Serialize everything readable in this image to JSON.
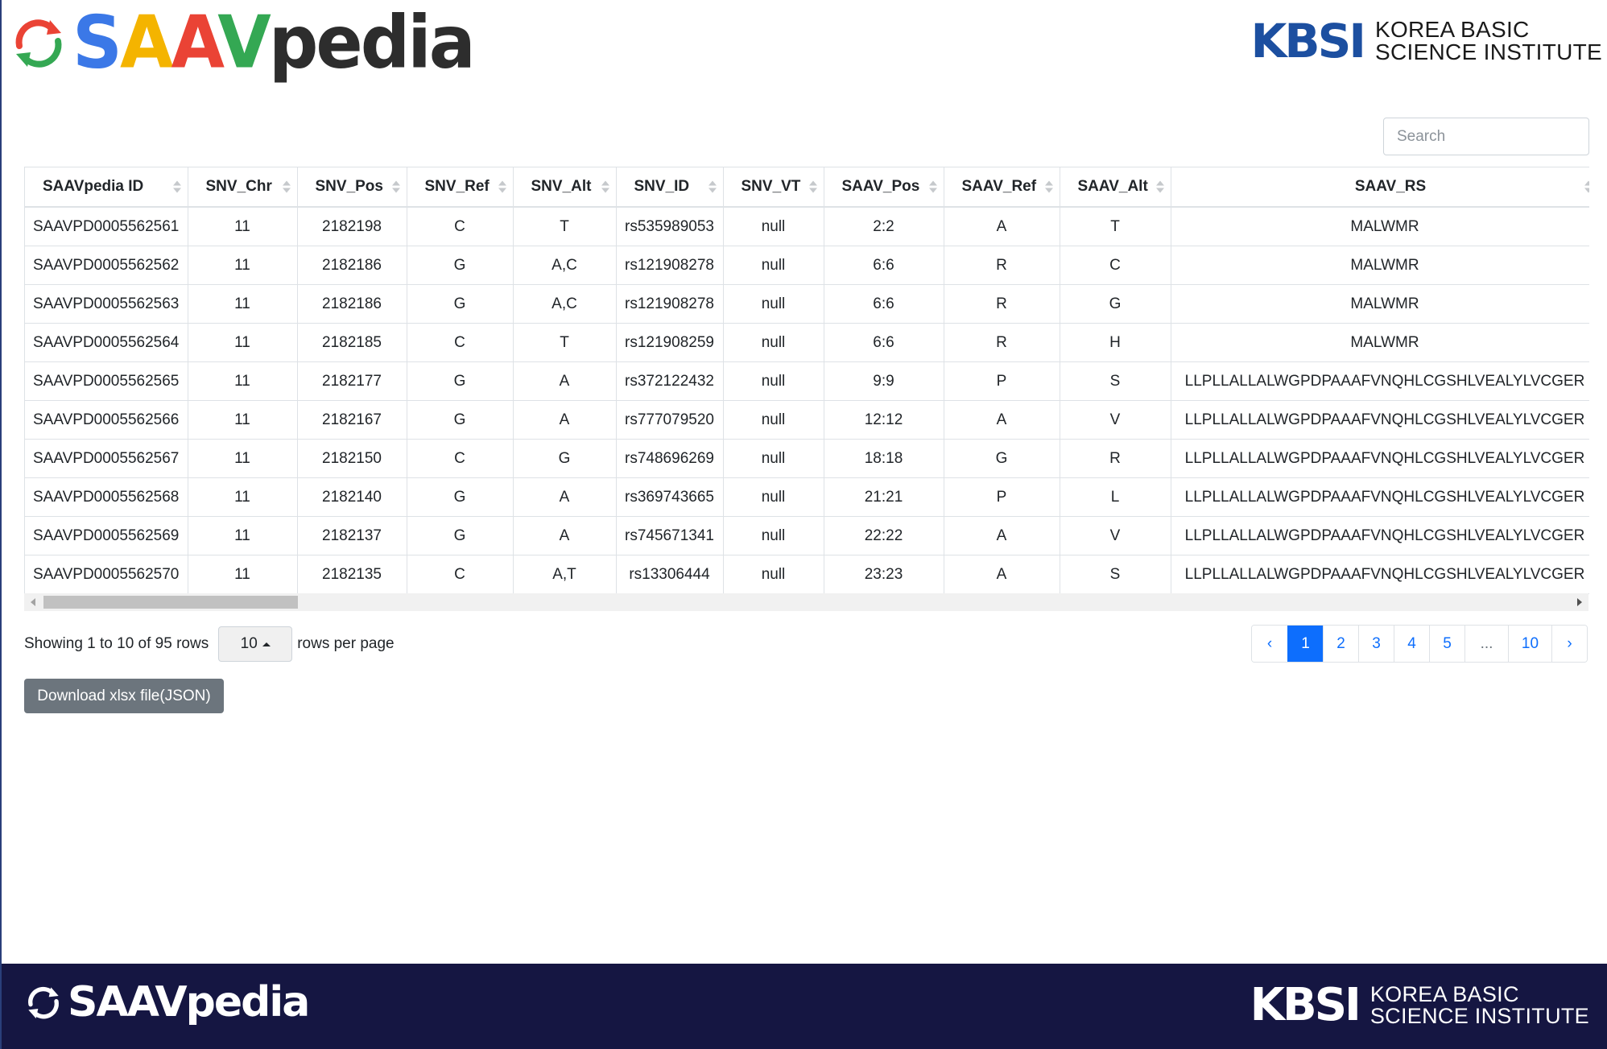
{
  "header": {
    "logo_text": "SAAVpedia",
    "partner_mark": "KBSI",
    "partner_line1": "KOREA BASIC",
    "partner_line2": "SCIENCE INSTITUTE"
  },
  "search": {
    "placeholder": "Search"
  },
  "table": {
    "columns": [
      "SAAVpedia ID",
      "SNV_Chr",
      "SNV_Pos",
      "SNV_Ref",
      "SNV_Alt",
      "SNV_ID",
      "SNV_VT",
      "SAAV_Pos",
      "SAAV_Ref",
      "SAAV_Alt",
      "SAAV_RS"
    ],
    "rows": [
      [
        "SAAVPD0005562561",
        "11",
        "2182198",
        "C",
        "T",
        "rs535989053",
        "null",
        "2:2",
        "A",
        "T",
        "MALWMR"
      ],
      [
        "SAAVPD0005562562",
        "11",
        "2182186",
        "G",
        "A,C",
        "rs121908278",
        "null",
        "6:6",
        "R",
        "C",
        "MALWMR"
      ],
      [
        "SAAVPD0005562563",
        "11",
        "2182186",
        "G",
        "A,C",
        "rs121908278",
        "null",
        "6:6",
        "R",
        "G",
        "MALWMR"
      ],
      [
        "SAAVPD0005562564",
        "11",
        "2182185",
        "C",
        "T",
        "rs121908259",
        "null",
        "6:6",
        "R",
        "H",
        "MALWMR"
      ],
      [
        "SAAVPD0005562565",
        "11",
        "2182177",
        "G",
        "A",
        "rs372122432",
        "null",
        "9:9",
        "P",
        "S",
        "LLPLLALLALWGPDPAAAFVNQHLCGSHLVEALYLVCGER"
      ],
      [
        "SAAVPD0005562566",
        "11",
        "2182167",
        "G",
        "A",
        "rs777079520",
        "null",
        "12:12",
        "A",
        "V",
        "LLPLLALLALWGPDPAAAFVNQHLCGSHLVEALYLVCGER"
      ],
      [
        "SAAVPD0005562567",
        "11",
        "2182150",
        "C",
        "G",
        "rs748696269",
        "null",
        "18:18",
        "G",
        "R",
        "LLPLLALLALWGPDPAAAFVNQHLCGSHLVEALYLVCGER"
      ],
      [
        "SAAVPD0005562568",
        "11",
        "2182140",
        "G",
        "A",
        "rs369743665",
        "null",
        "21:21",
        "P",
        "L",
        "LLPLLALLALWGPDPAAAFVNQHLCGSHLVEALYLVCGER"
      ],
      [
        "SAAVPD0005562569",
        "11",
        "2182137",
        "G",
        "A",
        "rs745671341",
        "null",
        "22:22",
        "A",
        "V",
        "LLPLLALLALWGPDPAAAFVNQHLCGSHLVEALYLVCGER"
      ],
      [
        "SAAVPD0005562570",
        "11",
        "2182135",
        "C",
        "A,T",
        "rs13306444",
        "null",
        "23:23",
        "A",
        "S",
        "LLPLLALLALWGPDPAAAFVNQHLCGSHLVEALYLVCGER"
      ]
    ]
  },
  "pagination": {
    "info_text": "Showing 1 to 10 of 95 rows",
    "page_size": "10",
    "page_size_suffix": "rows per page",
    "prev": "‹",
    "next": "›",
    "pages": [
      "1",
      "2",
      "3",
      "4",
      "5",
      "...",
      "10"
    ],
    "active_page": "1"
  },
  "download": {
    "label": "Download xlsx file(JSON)"
  },
  "footer": {
    "logo_text": "SAAVpedia",
    "partner_mark": "KBSI",
    "partner_line1": "KOREA BASIC",
    "partner_line2": "SCIENCE INSTITUTE"
  },
  "colors": {
    "primary": "#0d6efd",
    "footer_bg": "#151642",
    "button_bg": "#6c757d",
    "kbsi_blue": "#1c4fa0",
    "logo_green": "#34a853",
    "logo_red": "#ea4335"
  },
  "icons": {
    "logo_icon": "refresh-arrows-icon",
    "sort_icon": "sort-arrows-icon",
    "page_size_caret": "caret-up-icon"
  }
}
